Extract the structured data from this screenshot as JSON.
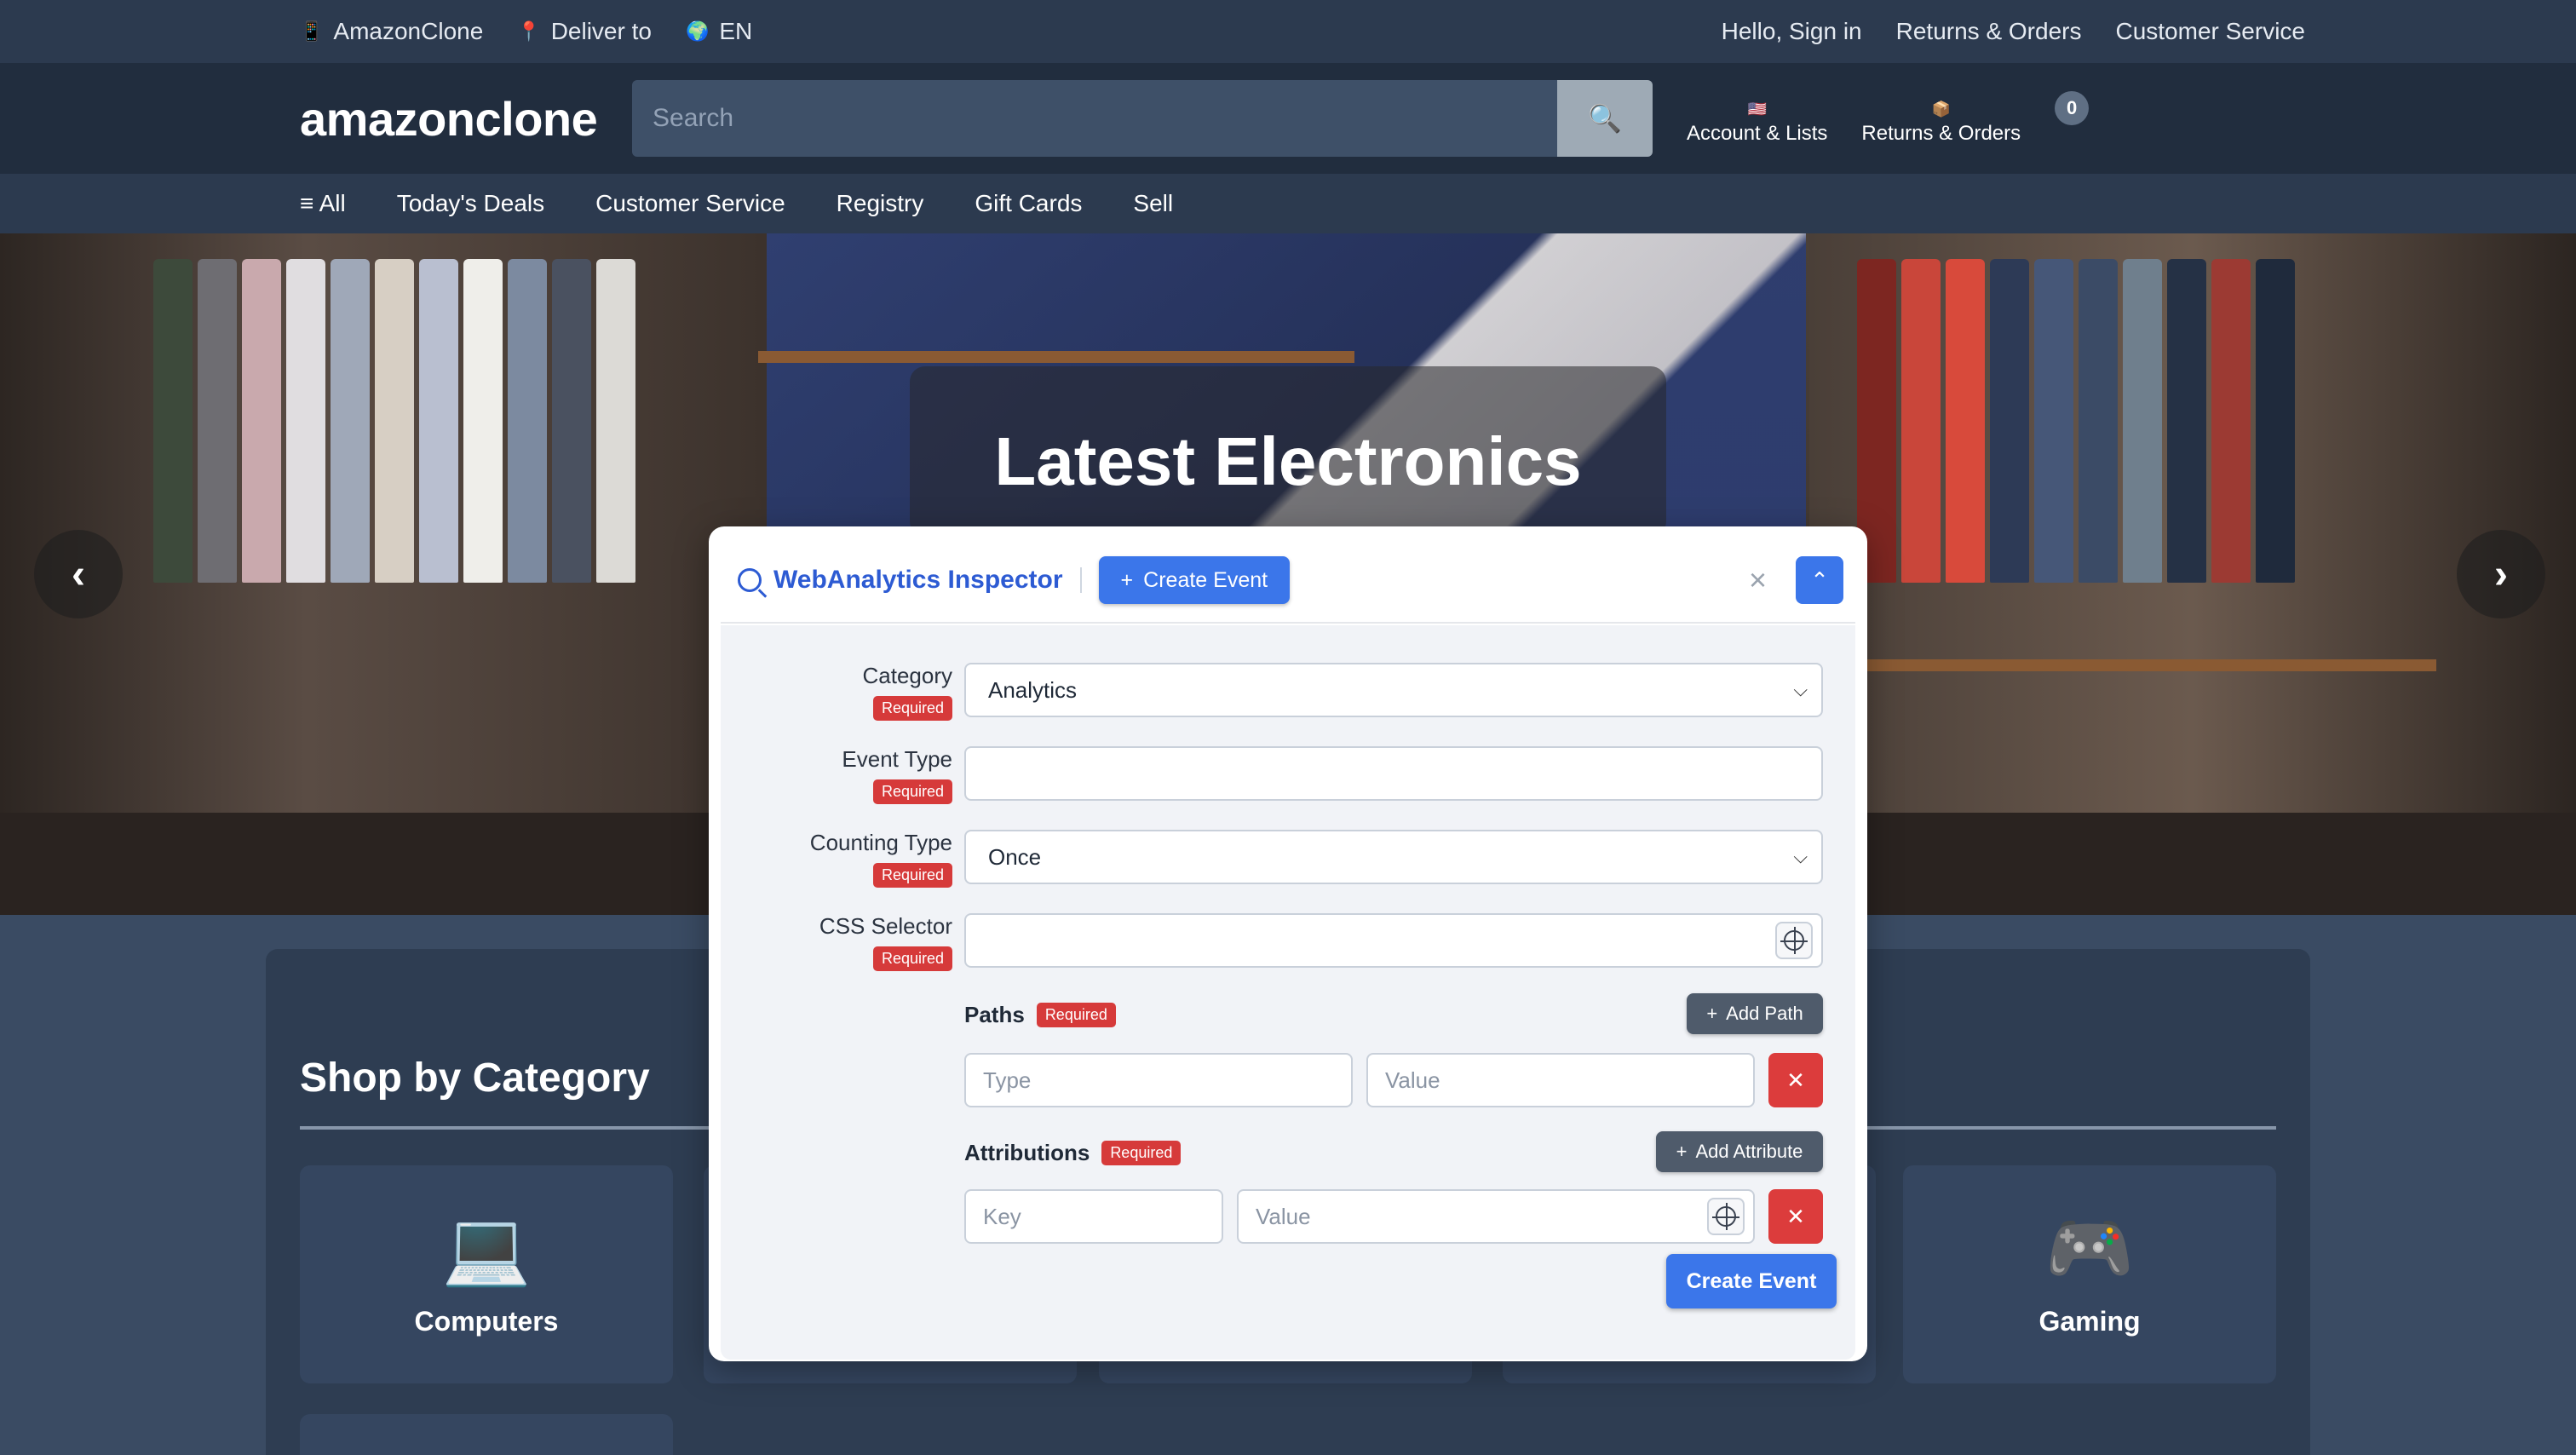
{
  "topbar": {
    "brand": "AmazonClone",
    "brand_icon": "phone-icon",
    "deliver_to": "Deliver to",
    "deliver_icon": "pin-icon",
    "language": "EN",
    "language_icon": "globe-icon",
    "links": [
      "Hello, Sign in",
      "Returns & Orders",
      "Customer Service"
    ]
  },
  "header": {
    "logo": "amazonclone",
    "search_placeholder": "Search",
    "search_icon": "magnifier-icon",
    "account_label": "Account & Lists",
    "account_icon": "flag-icon",
    "returns_label": "Returns & Orders",
    "returns_icon": "package-icon",
    "cart_count": "0"
  },
  "nav": {
    "all_icon": "≡",
    "items": [
      "All",
      "Today's Deals",
      "Customer Service",
      "Registry",
      "Gift Cards",
      "Sell"
    ]
  },
  "hero": {
    "title": "Latest Electronics",
    "prev": "‹",
    "next": "›"
  },
  "categories": {
    "heading": "Shop by Category",
    "items": [
      {
        "label": "Computers",
        "icon": "💻"
      },
      {
        "label": "Gaming",
        "icon": "🎮"
      }
    ]
  },
  "inspector": {
    "title": "WebAnalytics Inspector",
    "create_event_label": "Create Event",
    "close_glyph": "×",
    "collapse_glyph": "⌃",
    "required_label": "Required",
    "fields": {
      "category": {
        "label": "Category",
        "value": "Analytics"
      },
      "event_type": {
        "label": "Event Type",
        "value": ""
      },
      "counting_type": {
        "label": "Counting Type",
        "value": "Once"
      },
      "css_selector": {
        "label": "CSS Selector",
        "value": ""
      }
    },
    "paths": {
      "label": "Paths",
      "add_label": "Add Path",
      "type_placeholder": "Type",
      "value_placeholder": "Value"
    },
    "attributions": {
      "label": "Attributions",
      "add_label": "Add Attribute",
      "key_placeholder": "Key",
      "value_placeholder": "Value"
    },
    "submit_label": "Create Event"
  },
  "colors": {
    "accent": "#3b76ea",
    "danger": "#dc3c3c",
    "header_bg": "#212d3e",
    "topbar_bg": "#2c3a4f"
  }
}
